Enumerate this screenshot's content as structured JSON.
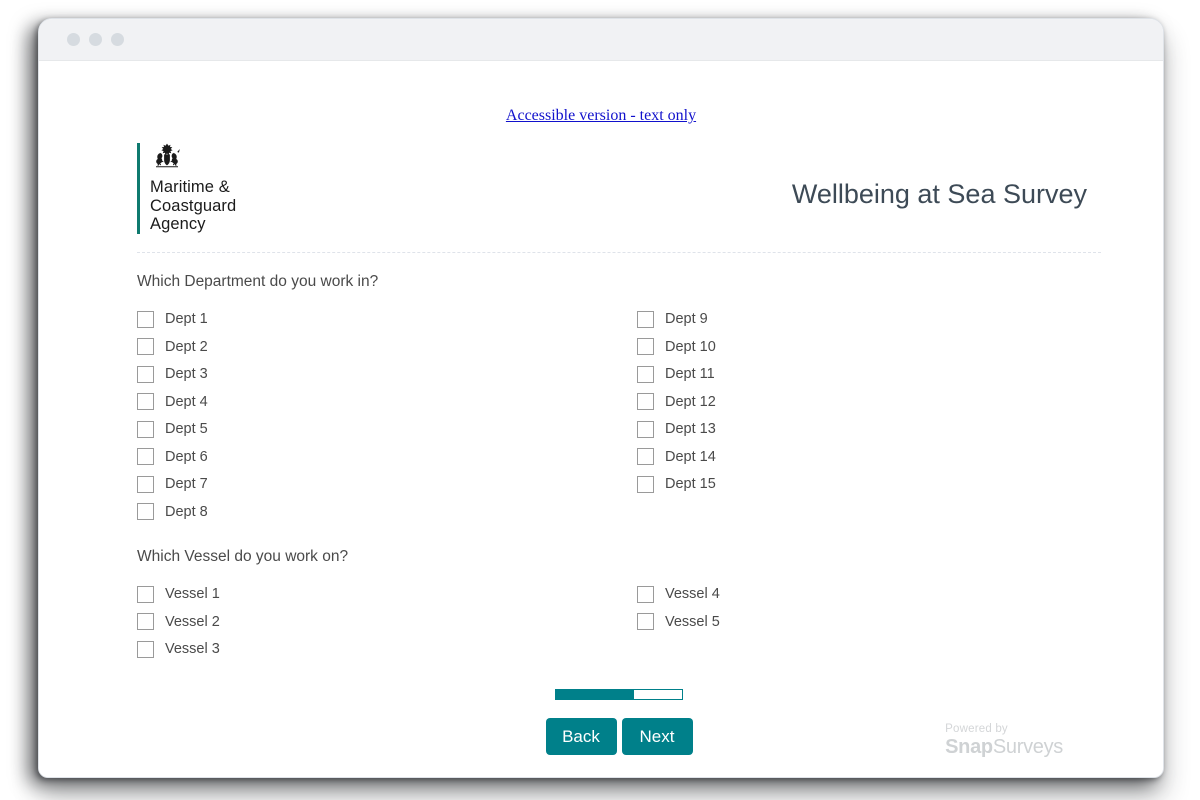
{
  "window": {
    "dots": [
      "close-dot",
      "minimize-dot",
      "maximize-dot"
    ]
  },
  "accessible_link": {
    "label": "Accessible version - text only",
    "color": "#1111cc"
  },
  "header": {
    "logo": {
      "crest_icon": "royal-coat-of-arms-icon",
      "bar_color": "#0f7a6f",
      "line1": "Maritime &",
      "line2": "Coastguard",
      "line3": "Agency"
    },
    "title": "Wellbeing at Sea Survey",
    "title_color": "#3d4a56"
  },
  "questions": [
    {
      "id": "department",
      "text": "Which Department do you work in?",
      "left_options": [
        "Dept 1",
        "Dept 2",
        "Dept 3",
        "Dept 4",
        "Dept 5",
        "Dept 6",
        "Dept 7",
        "Dept 8"
      ],
      "right_options": [
        "Dept 9",
        "Dept 10",
        "Dept 11",
        "Dept 12",
        "Dept 13",
        "Dept 14",
        "Dept 15"
      ]
    },
    {
      "id": "vessel",
      "text": "Which Vessel do you work on?",
      "left_options": [
        "Vessel 1",
        "Vessel 2",
        "Vessel 3"
      ],
      "right_options": [
        "Vessel 4",
        "Vessel 5"
      ]
    }
  ],
  "footer": {
    "progress": {
      "percent": 62,
      "fill_color": "#00808a"
    },
    "back_label": "Back",
    "next_label": "Next",
    "button_color": "#00808a",
    "branding": {
      "powered_by": "Powered by",
      "snap": "Snap",
      "surveys": "Surveys"
    }
  }
}
